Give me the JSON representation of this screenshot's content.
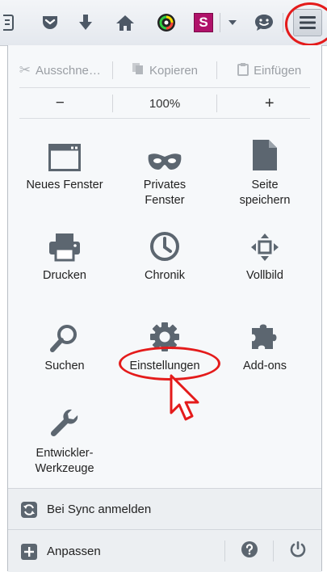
{
  "toolbar": {
    "icons": [
      "bookmarks-list-icon",
      "pocket-icon",
      "downloads-icon",
      "home-icon",
      "color-extension-icon",
      "s-extension-icon",
      "dropdown-arrow-icon",
      "chat-icon",
      "hamburger-menu-icon"
    ],
    "s_extension_letter": "S"
  },
  "edit": {
    "cut": "Ausschne…",
    "copy": "Kopieren",
    "paste": "Einfügen"
  },
  "zoom": {
    "minus": "−",
    "level": "100%",
    "plus": "+"
  },
  "grid": [
    {
      "label": "Neues Fenster",
      "icon": "new-window-icon"
    },
    {
      "label": "Privates Fenster",
      "icon": "private-mask-icon"
    },
    {
      "label": "Seite speichern",
      "icon": "save-page-icon"
    },
    {
      "label": "Drucken",
      "icon": "printer-icon"
    },
    {
      "label": "Chronik",
      "icon": "history-clock-icon"
    },
    {
      "label": "Vollbild",
      "icon": "fullscreen-icon"
    },
    {
      "label": "Suchen",
      "icon": "search-icon"
    },
    {
      "label": "Einstellungen",
      "icon": "gear-icon"
    },
    {
      "label": "Add-ons",
      "icon": "puzzle-icon"
    },
    {
      "label": "Entwickler-Werkzeuge",
      "icon": "wrench-icon"
    }
  ],
  "footer": {
    "sync": "Bei Sync anmelden",
    "customize": "Anpassen"
  },
  "colors": {
    "highlight": "#e41b1b",
    "icon": "#5c6670",
    "s_extension": "#b0126a"
  }
}
